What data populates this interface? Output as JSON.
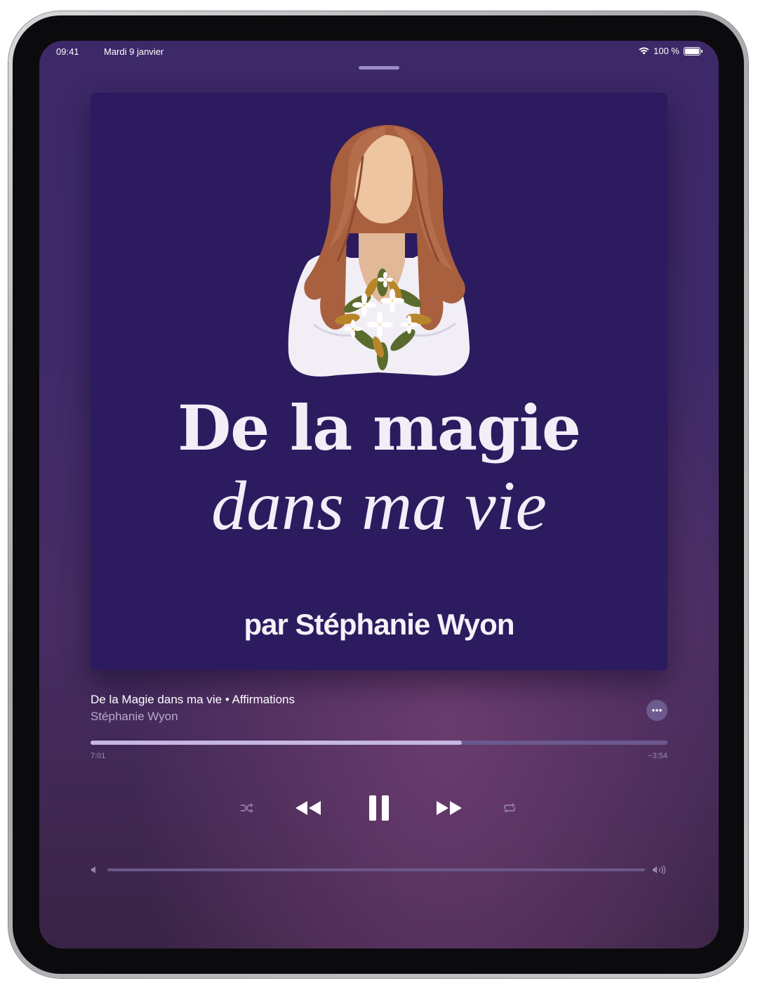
{
  "status_bar": {
    "time": "09:41",
    "date": "Mardi 9 janvier",
    "battery": "100 %"
  },
  "artwork": {
    "title_line1": "De la magie",
    "title_line2": "dans ma vie",
    "byline": "par Stéphanie Wyon",
    "background_color": "#2c1b5e"
  },
  "now_playing": {
    "title": "De la Magie dans ma vie • Affirmations",
    "artist": "Stéphanie Wyon",
    "more_icon": "ellipsis-icon"
  },
  "progress": {
    "elapsed": "7:01",
    "remaining": "−3:54",
    "fraction": 0.643
  },
  "controls": {
    "shuffle": "shuffle-icon",
    "previous": "backward-icon",
    "play_pause": "pause-icon",
    "next": "forward-icon",
    "repeat": "repeat-icon"
  },
  "volume": {
    "min_icon": "speaker-low-icon",
    "max_icon": "speaker-high-icon"
  }
}
